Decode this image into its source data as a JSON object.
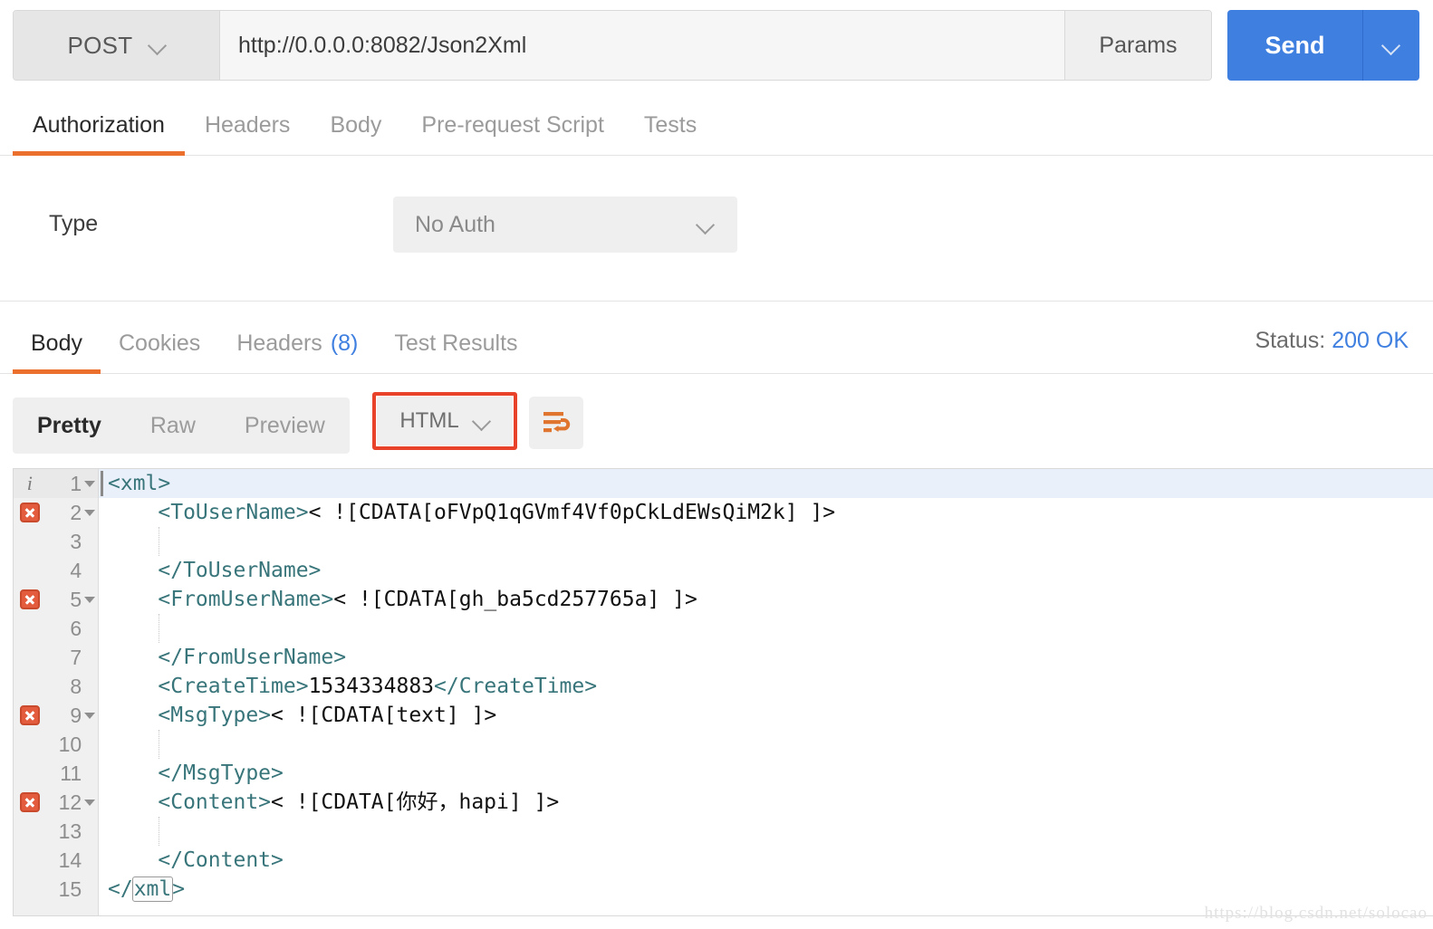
{
  "request": {
    "method": "POST",
    "url": "http://0.0.0.0:8082/Json2Xml",
    "params_label": "Params",
    "send_label": "Send",
    "tabs": [
      {
        "label": "Authorization",
        "active": true
      },
      {
        "label": "Headers",
        "active": false
      },
      {
        "label": "Body",
        "active": false
      },
      {
        "label": "Pre-request Script",
        "active": false
      },
      {
        "label": "Tests",
        "active": false
      }
    ]
  },
  "auth": {
    "type_label": "Type",
    "type_value": "No Auth"
  },
  "response": {
    "tabs": [
      {
        "label": "Body",
        "active": true
      },
      {
        "label": "Cookies",
        "active": false
      },
      {
        "label": "Headers",
        "active": false,
        "count": "(8)"
      },
      {
        "label": "Test Results",
        "active": false
      }
    ],
    "status_label": "Status:",
    "status_code": "200 OK",
    "formats": [
      {
        "label": "Pretty",
        "active": true
      },
      {
        "label": "Raw",
        "active": false
      },
      {
        "label": "Preview",
        "active": false
      }
    ],
    "language": "HTML",
    "wrap_icon": "word-wrap-icon"
  },
  "code": {
    "lines": [
      {
        "n": "1",
        "mark": "info",
        "fold": true,
        "active": true,
        "indent": 0,
        "guide": false,
        "parts": [
          {
            "t": "tag",
            "v": "<xml>"
          }
        ]
      },
      {
        "n": "2",
        "mark": "error",
        "fold": true,
        "active": false,
        "indent": 1,
        "guide": false,
        "parts": [
          {
            "t": "tag",
            "v": "<ToUserName>"
          },
          {
            "t": "txt",
            "v": "< ![CDATA[oFVpQ1qGVmf4Vf0pCkLdEWsQiM2k] ]>"
          }
        ]
      },
      {
        "n": "3",
        "mark": "",
        "fold": false,
        "active": false,
        "indent": 1,
        "guide": true,
        "parts": []
      },
      {
        "n": "4",
        "mark": "",
        "fold": false,
        "active": false,
        "indent": 1,
        "guide": false,
        "parts": [
          {
            "t": "tag",
            "v": "</ToUserName>"
          }
        ]
      },
      {
        "n": "5",
        "mark": "error",
        "fold": true,
        "active": false,
        "indent": 1,
        "guide": false,
        "parts": [
          {
            "t": "tag",
            "v": "<FromUserName>"
          },
          {
            "t": "txt",
            "v": "< ![CDATA[gh_ba5cd257765a] ]>"
          }
        ]
      },
      {
        "n": "6",
        "mark": "",
        "fold": false,
        "active": false,
        "indent": 1,
        "guide": true,
        "parts": []
      },
      {
        "n": "7",
        "mark": "",
        "fold": false,
        "active": false,
        "indent": 1,
        "guide": false,
        "parts": [
          {
            "t": "tag",
            "v": "</FromUserName>"
          }
        ]
      },
      {
        "n": "8",
        "mark": "",
        "fold": false,
        "active": false,
        "indent": 1,
        "guide": false,
        "parts": [
          {
            "t": "tag",
            "v": "<CreateTime>"
          },
          {
            "t": "txt",
            "v": "1534334883"
          },
          {
            "t": "tag",
            "v": "</CreateTime>"
          }
        ]
      },
      {
        "n": "9",
        "mark": "error",
        "fold": true,
        "active": false,
        "indent": 1,
        "guide": false,
        "parts": [
          {
            "t": "tag",
            "v": "<MsgType>"
          },
          {
            "t": "txt",
            "v": "< ![CDATA[text] ]>"
          }
        ]
      },
      {
        "n": "10",
        "mark": "",
        "fold": false,
        "active": false,
        "indent": 1,
        "guide": true,
        "parts": []
      },
      {
        "n": "11",
        "mark": "",
        "fold": false,
        "active": false,
        "indent": 1,
        "guide": false,
        "parts": [
          {
            "t": "tag",
            "v": "</MsgType>"
          }
        ]
      },
      {
        "n": "12",
        "mark": "error",
        "fold": true,
        "active": false,
        "indent": 1,
        "guide": false,
        "parts": [
          {
            "t": "tag",
            "v": "<Content>"
          },
          {
            "t": "txt",
            "v": "< ![CDATA[你好，hapi] ]>"
          }
        ]
      },
      {
        "n": "13",
        "mark": "",
        "fold": false,
        "active": false,
        "indent": 1,
        "guide": true,
        "parts": []
      },
      {
        "n": "14",
        "mark": "",
        "fold": false,
        "active": false,
        "indent": 1,
        "guide": false,
        "parts": [
          {
            "t": "tag",
            "v": "</Content>"
          }
        ]
      },
      {
        "n": "15",
        "mark": "",
        "fold": false,
        "active": false,
        "indent": 0,
        "guide": false,
        "parts": [
          {
            "t": "tag",
            "v": "</"
          },
          {
            "t": "tag-match",
            "v": "xml"
          },
          {
            "t": "tag",
            "v": ">"
          }
        ]
      }
    ]
  },
  "watermark": "https://blog.csdn.net/solocao",
  "colors": {
    "accent_orange": "#eb6f2d",
    "send_blue": "#3f7fe0",
    "status_blue": "#3f7fe0",
    "annotation_red": "#e8432a",
    "xml_tag_teal": "#38757a"
  }
}
